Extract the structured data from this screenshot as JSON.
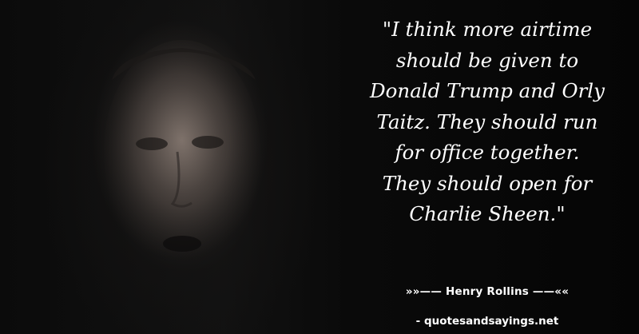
{
  "quote": {
    "lines": [
      "\"I think more airtime",
      "should be given to",
      "Donald Trump and Orly",
      "Taitz. They should run",
      "for office together.",
      "They should open for",
      "Charlie Sheen.\""
    ]
  },
  "author": {
    "text": "»»—— Henry Rollins ——««"
  },
  "site": {
    "text": "- quotesandsayings.net"
  },
  "colors": {
    "text": "#ffffff",
    "background": "#050505"
  }
}
